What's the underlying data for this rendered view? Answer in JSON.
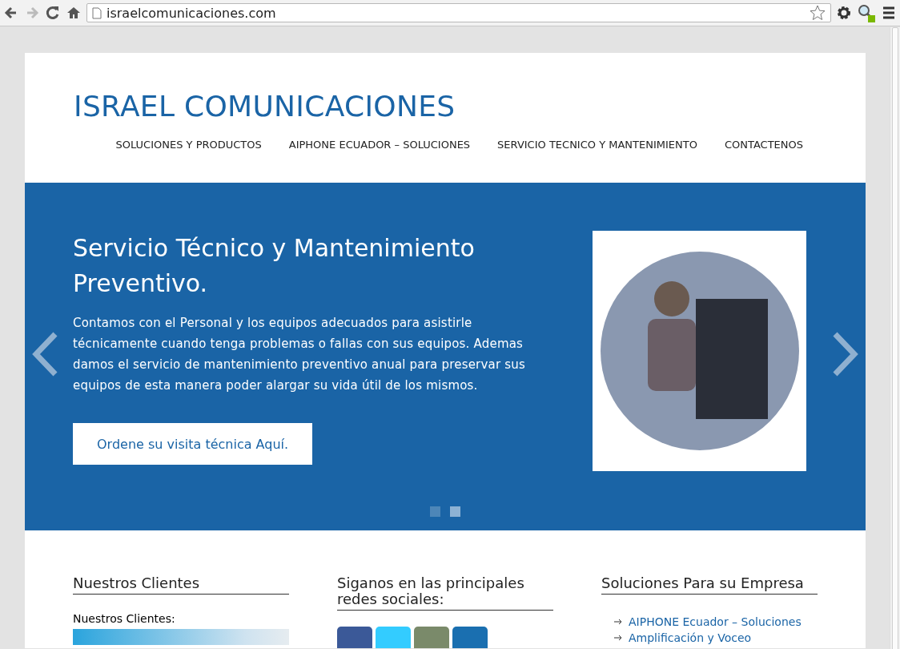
{
  "browser": {
    "url": "israelcomunicaciones.com"
  },
  "site": {
    "title": "ISRAEL COMUNICACIONES"
  },
  "nav": [
    {
      "label": "SOLUCIONES Y PRODUCTOS"
    },
    {
      "label": "AIPHONE ECUADOR – SOLUCIONES"
    },
    {
      "label": "SERVICIO TECNICO Y MANTENIMIENTO"
    },
    {
      "label": "CONTACTENOS"
    }
  ],
  "slider": {
    "heading": "Servicio Técnico y Mantenimiento Preventivo.",
    "text": "Contamos con el Personal y los equipos adecuados para asistirle técnicamente cuando tenga problemas o fallas con sus equipos. Ademas damos el servicio de mantenimiento preventivo anual para preservar sus equipos de esta manera poder alargar su vida útil de los mismos.",
    "button": "Ordene su visita técnica Aquí.",
    "dots": [
      {
        "selected": false
      },
      {
        "selected": true
      }
    ]
  },
  "widgets": [
    {
      "kind": "clients",
      "title": "Nuestros Clientes",
      "label": "Nuestros Clientes:"
    },
    {
      "kind": "social",
      "title": "Siganos en las principales redes sociales:",
      "icons": [
        {
          "color": "#3b5998"
        },
        {
          "color": "#33ccff"
        },
        {
          "color": "#7a8a6a"
        },
        {
          "color": "#1a6fb0"
        }
      ]
    },
    {
      "kind": "links",
      "title": "Soluciones Para su Empresa",
      "links": [
        "AIPHONE Ecuador – Soluciones",
        "Amplificación y Voceo"
      ]
    }
  ]
}
